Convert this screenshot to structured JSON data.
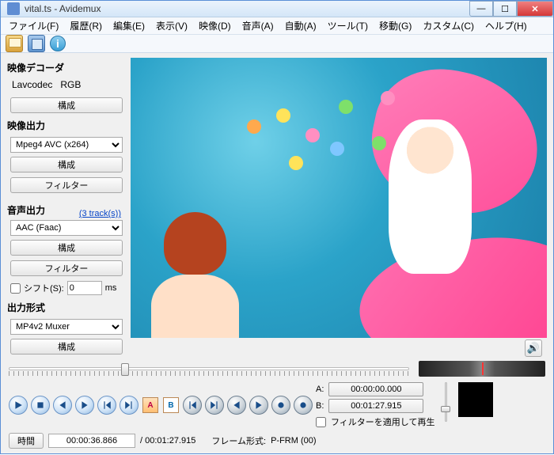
{
  "window": {
    "title": "vital.ts - Avidemux"
  },
  "menu": {
    "file": "ファイル(F)",
    "history": "履歴(R)",
    "edit": "編集(E)",
    "view": "表示(V)",
    "video": "映像(D)",
    "audio": "音声(A)",
    "auto": "自動(A)",
    "tools": "ツール(T)",
    "go": "移動(G)",
    "custom": "カスタム(C)",
    "help": "ヘルプ(H)"
  },
  "side": {
    "video_decoder_label": "映像デコーダ",
    "decoder_name": "Lavcodec",
    "decoder_colorspace": "RGB",
    "configure": "構成",
    "video_output_label": "映像出力",
    "video_codec": "Mpeg4 AVC (x264)",
    "filter": "フィルター",
    "audio_output_label": "音声出力",
    "tracks_link": "(3 track(s))",
    "audio_codec": "AAC (Faac)",
    "shift_label": "シフト(S):",
    "shift_value": "0",
    "shift_unit": "ms",
    "output_format_label": "出力形式",
    "muxer": "MP4v2 Muxer"
  },
  "bottom": {
    "a_label": "A:",
    "b_label": "B:",
    "a_time": "00:00:00.000",
    "b_time": "00:01:27.915",
    "apply_filter_playback": "フィルターを適用して再生",
    "time_btn": "時間",
    "current_time": "00:00:36.866",
    "total_time": "/ 00:01:27.915",
    "frame_type_label": "フレーム形式:",
    "frame_type_value": "P-FRM (00)"
  }
}
